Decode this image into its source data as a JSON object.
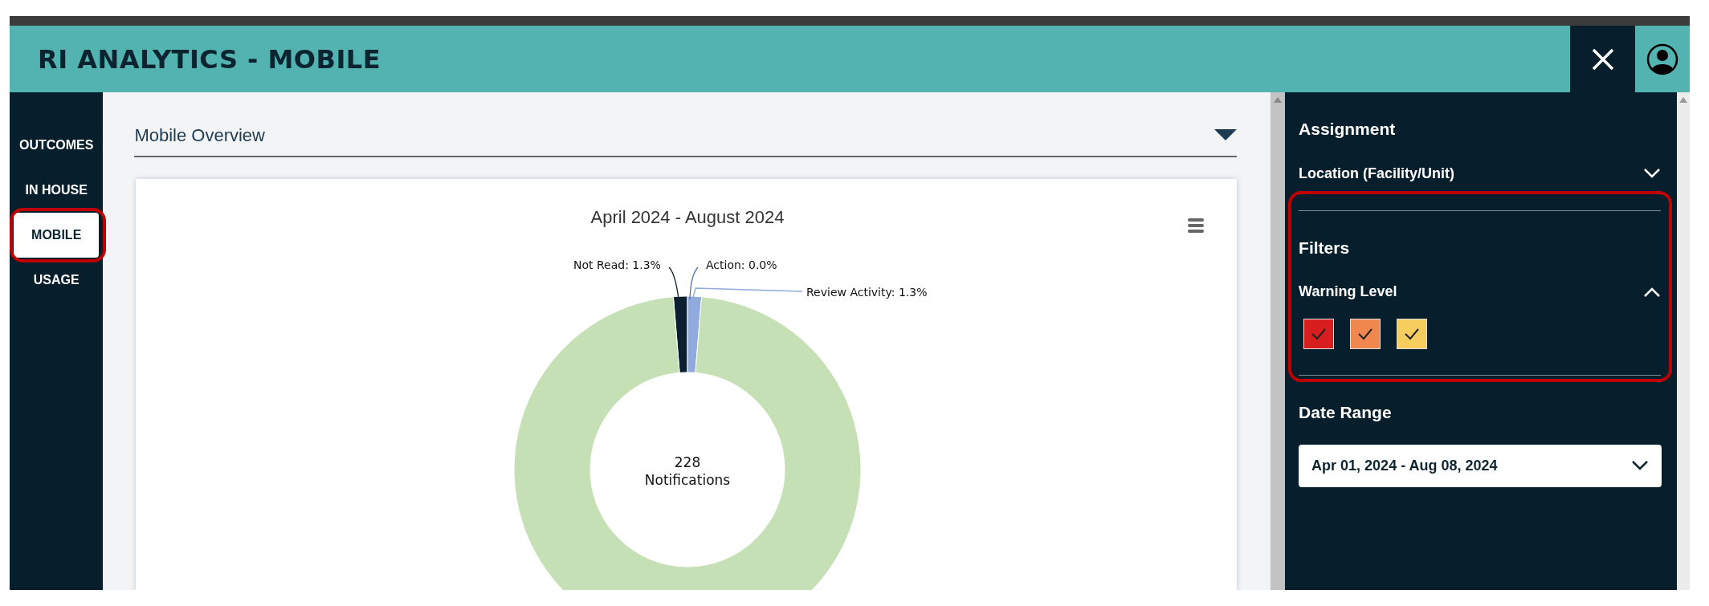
{
  "header": {
    "title": "RI ANALYTICS - MOBILE"
  },
  "sidebar": {
    "items": [
      {
        "label": "OUTCOMES",
        "selected": false
      },
      {
        "label": "IN HOUSE",
        "selected": false
      },
      {
        "label": "MOBILE",
        "selected": true
      },
      {
        "label": "USAGE",
        "selected": false
      }
    ]
  },
  "main": {
    "view_selector": {
      "value": "Mobile Overview"
    },
    "chart": {
      "center_value": "228",
      "chart_data": {
        "type": "donut",
        "title": "April 2024 - August 2024",
        "series": [
          {
            "name": "Notifications",
            "values": [
              1.3,
              0.0,
              1.3,
              97.4
            ]
          }
        ],
        "colors": [
          "#0b1f2e",
          "#4f6fb0",
          "#8faadc",
          "#c5e0b4"
        ],
        "value_labels": [
          "Not Read: 1.3%",
          "Action: 0.0%",
          "Review Activity: 1.3%",
          null
        ]
      }
    }
  },
  "filter_panel": {
    "sections": [
      {
        "title": "Assignment",
        "dropdowns": [
          {
            "label": "Location (Facility/Unit)",
            "expanded": false
          }
        ]
      },
      {
        "title": "Filters",
        "dropdowns": [
          {
            "label": "Warning Level",
            "expanded": true,
            "checkboxes": [
              {
                "color": "#d81e1e",
                "checked": true
              },
              {
                "color": "#f0874f",
                "checked": true
              },
              {
                "color": "#f6cd5e",
                "checked": true
              }
            ]
          }
        ]
      },
      {
        "title": "Date Range",
        "select": {
          "value": "Apr 01, 2024 - Aug 08, 2024"
        }
      }
    ]
  }
}
